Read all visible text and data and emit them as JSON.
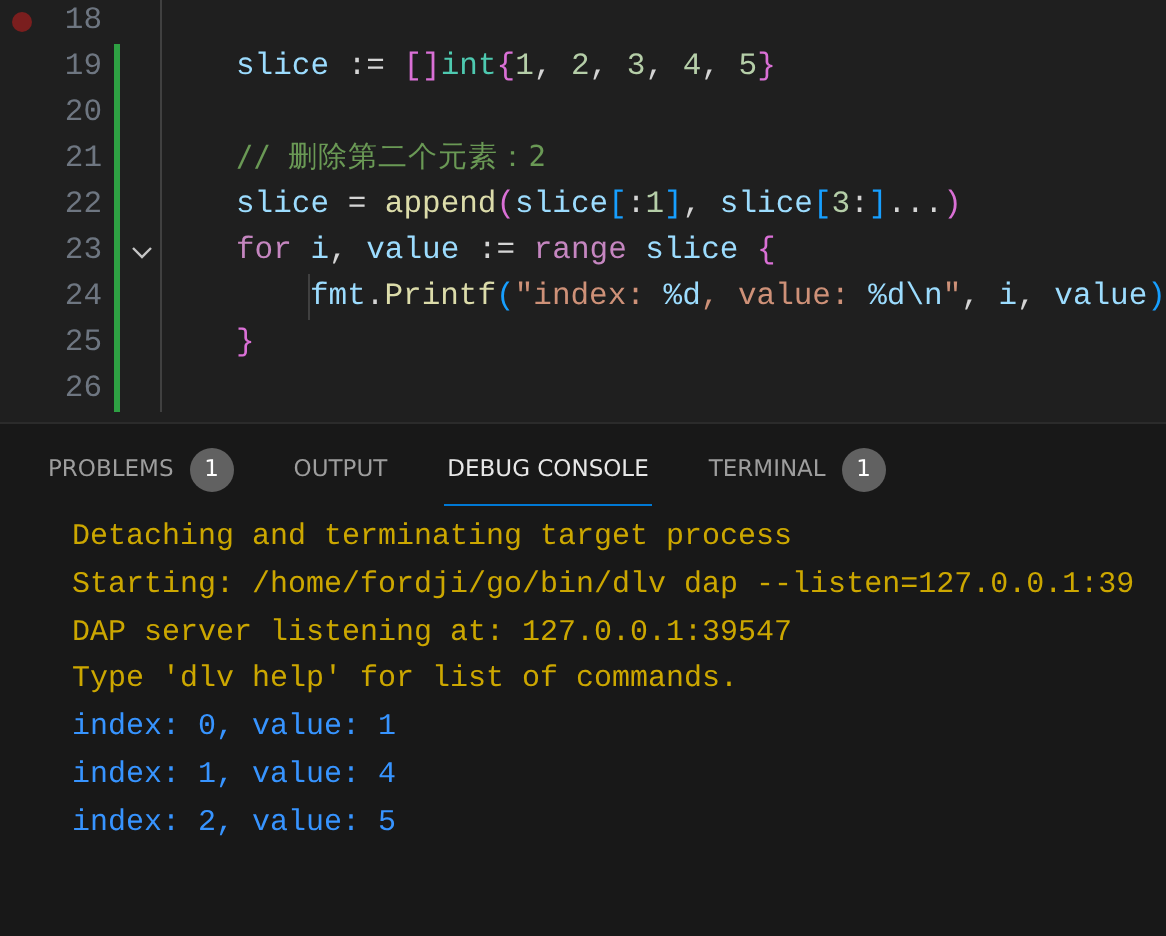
{
  "editor": {
    "lines": [
      {
        "number": "18",
        "breakpoint": true,
        "modified": false
      },
      {
        "number": "19",
        "breakpoint": false,
        "modified": true,
        "tokens": [
          {
            "kind": "var",
            "text": "slice"
          },
          {
            "kind": "op",
            "text": " := "
          },
          {
            "kind": "bracket",
            "text": "[]"
          },
          {
            "kind": "type",
            "text": "int"
          },
          {
            "kind": "bracket",
            "text": "{"
          },
          {
            "kind": "number",
            "text": "1"
          },
          {
            "kind": "op",
            "text": ", "
          },
          {
            "kind": "number",
            "text": "2"
          },
          {
            "kind": "op",
            "text": ", "
          },
          {
            "kind": "number",
            "text": "3"
          },
          {
            "kind": "op",
            "text": ", "
          },
          {
            "kind": "number",
            "text": "4"
          },
          {
            "kind": "op",
            "text": ", "
          },
          {
            "kind": "number",
            "text": "5"
          },
          {
            "kind": "bracket",
            "text": "}"
          }
        ]
      },
      {
        "number": "20",
        "breakpoint": false,
        "modified": true
      },
      {
        "number": "21",
        "breakpoint": false,
        "modified": true,
        "tokens": [
          {
            "kind": "comment",
            "text": "// 删除第二个元素：2"
          }
        ]
      },
      {
        "number": "22",
        "breakpoint": false,
        "modified": true,
        "tokens": [
          {
            "kind": "var",
            "text": "slice"
          },
          {
            "kind": "op",
            "text": " = "
          },
          {
            "kind": "func",
            "text": "append"
          },
          {
            "kind": "bracket",
            "text": "("
          },
          {
            "kind": "var",
            "text": "slice"
          },
          {
            "kind": "bracket2",
            "text": "["
          },
          {
            "kind": "op",
            "text": ":"
          },
          {
            "kind": "number",
            "text": "1"
          },
          {
            "kind": "bracket2",
            "text": "]"
          },
          {
            "kind": "op",
            "text": ", "
          },
          {
            "kind": "var",
            "text": "slice"
          },
          {
            "kind": "bracket2",
            "text": "["
          },
          {
            "kind": "number",
            "text": "3"
          },
          {
            "kind": "op",
            "text": ":"
          },
          {
            "kind": "bracket2",
            "text": "]"
          },
          {
            "kind": "op",
            "text": "..."
          },
          {
            "kind": "bracket",
            "text": ")"
          }
        ]
      },
      {
        "number": "23",
        "breakpoint": false,
        "modified": true,
        "expanded": true,
        "tokens": [
          {
            "kind": "keyword",
            "text": "for"
          },
          {
            "kind": "var",
            "text": " i"
          },
          {
            "kind": "op",
            "text": ", "
          },
          {
            "kind": "var",
            "text": "value"
          },
          {
            "kind": "op",
            "text": " := "
          },
          {
            "kind": "keyword",
            "text": "range"
          },
          {
            "kind": "var",
            "text": " slice"
          },
          {
            "kind": "bracket",
            "text": " {"
          }
        ],
        "children": [
          {
            "number": "24",
            "breakpoint": false,
            "modified": true,
            "tokens": [
              {
                "kind": "var",
                "text": "fmt"
              },
              {
                "kind": "op",
                "text": "."
              },
              {
                "kind": "func",
                "text": "Printf"
              },
              {
                "kind": "bracket2",
                "text": "("
              },
              {
                "kind": "string",
                "text": "\"index: "
              },
              {
                "kind": "var",
                "text": "%d"
              },
              {
                "kind": "string",
                "text": ", value: "
              },
              {
                "kind": "var",
                "text": "%d\\n"
              },
              {
                "kind": "string",
                "text": "\""
              },
              {
                "kind": "op",
                "text": ", "
              },
              {
                "kind": "var",
                "text": "i"
              },
              {
                "kind": "op",
                "text": ", "
              },
              {
                "kind": "var",
                "text": "value"
              },
              {
                "kind": "bracket2",
                "text": ")"
              }
            ]
          }
        ]
      },
      {
        "number": "25",
        "breakpoint": false,
        "modified": true,
        "tokens": [
          {
            "kind": "bracket",
            "text": "}"
          }
        ]
      },
      {
        "number": "26",
        "breakpoint": false,
        "modified": true
      }
    ]
  },
  "panel": {
    "tabs": [
      {
        "label": "PROBLEMS",
        "badge": "1",
        "selected": false
      },
      {
        "label": "OUTPUT",
        "selected": false
      },
      {
        "label": "DEBUG CONSOLE",
        "selected": true
      },
      {
        "label": "TERMINAL",
        "badge": "1",
        "selected": false
      }
    ],
    "console": [
      {
        "kind": "info",
        "text": "Detaching and terminating target process"
      },
      {
        "kind": "info",
        "text": "Starting: /home/fordji/go/bin/dlv dap --listen=127.0.0.1:39"
      },
      {
        "kind": "info",
        "text": "DAP server listening at: 127.0.0.1:39547"
      },
      {
        "kind": "info",
        "text": "Type 'dlv help' for list of commands."
      },
      {
        "kind": "output",
        "text": "index: 0, value: 1"
      },
      {
        "kind": "output",
        "text": "index: 1, value: 4"
      },
      {
        "kind": "output",
        "text": "index: 2, value: 5"
      }
    ]
  }
}
